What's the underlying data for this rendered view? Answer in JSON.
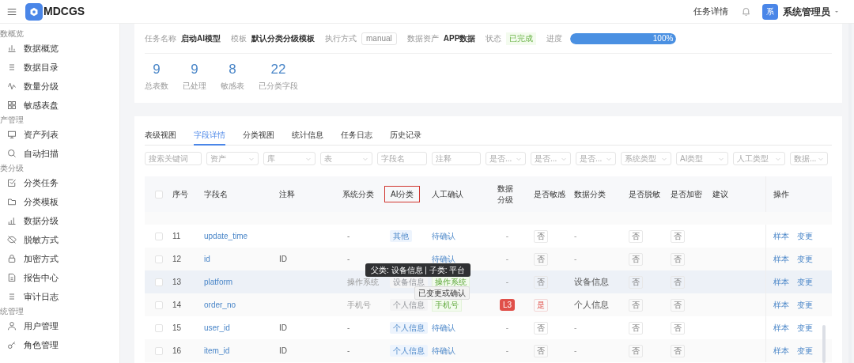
{
  "app": {
    "logo_text": "MDCGS",
    "page_title": "任务详情",
    "avatar": "系",
    "user": "系统管理员"
  },
  "sidebar": [
    {
      "kind": "section",
      "label": "数概览"
    },
    {
      "kind": "item",
      "label": "数据概览",
      "selected": false
    },
    {
      "kind": "item",
      "label": "数据目录",
      "selected": false
    },
    {
      "kind": "item",
      "label": "数量分级",
      "selected": false
    },
    {
      "kind": "item",
      "label": "敏感表盘",
      "selected": false
    },
    {
      "kind": "section",
      "label": "产管理"
    },
    {
      "kind": "item",
      "label": "资产列表",
      "selected": false
    },
    {
      "kind": "item",
      "label": "自动扫描",
      "selected": false
    },
    {
      "kind": "section",
      "label": "类分级"
    },
    {
      "kind": "item",
      "label": "分类任务",
      "selected": false
    },
    {
      "kind": "item",
      "label": "分类模板",
      "selected": false
    },
    {
      "kind": "item",
      "label": "数据分级",
      "selected": false
    },
    {
      "kind": "item",
      "label": "脱敏方式",
      "selected": false
    },
    {
      "kind": "item",
      "label": "加密方式",
      "selected": false
    },
    {
      "kind": "item",
      "label": "报告中心",
      "selected": false
    },
    {
      "kind": "item",
      "label": "审计日志",
      "selected": false
    },
    {
      "kind": "section",
      "label": "统管理"
    },
    {
      "kind": "item",
      "label": "用户管理",
      "selected": false
    },
    {
      "kind": "item",
      "label": "角色管理",
      "selected": false
    }
  ],
  "task": {
    "fields": [
      {
        "kind": "text",
        "label": "任务名称",
        "value": "启动AI模型"
      },
      {
        "kind": "text",
        "label": "模板",
        "value": "默认分类分级模板"
      },
      {
        "kind": "tag",
        "label": "执行方式",
        "value": "manual"
      },
      {
        "kind": "text",
        "label": "数据资产",
        "value": "APP数据"
      },
      {
        "kind": "status",
        "label": "状态",
        "value": "已完成"
      },
      {
        "kind": "progress",
        "label": "进度",
        "value": "100%",
        "level": 1
      }
    ],
    "stats": [
      {
        "value": "9",
        "label": "总表数"
      },
      {
        "value": "9",
        "label": "已处理"
      },
      {
        "value": "8",
        "label": "敏感表"
      },
      {
        "value": "22",
        "label": "已分类字段"
      }
    ]
  },
  "tabs": [
    {
      "label": "表级视图",
      "selected": false
    },
    {
      "label": "字段详情",
      "selected": true
    },
    {
      "label": "分类视图",
      "selected": false
    },
    {
      "label": "统计信息",
      "selected": false
    },
    {
      "label": "任务日志",
      "selected": false
    },
    {
      "label": "历史记录",
      "selected": false
    }
  ],
  "filters": [
    {
      "kind": "input",
      "placeholder": "搜索关键词"
    },
    {
      "kind": "select",
      "placeholder": "资产"
    },
    {
      "kind": "select",
      "placeholder": "库"
    },
    {
      "kind": "select",
      "placeholder": "表"
    },
    {
      "kind": "input",
      "placeholder": "字段名"
    },
    {
      "kind": "input",
      "placeholder": "注释"
    },
    {
      "kind": "select",
      "placeholder": "是否..."
    },
    {
      "kind": "select",
      "placeholder": "是否..."
    },
    {
      "kind": "select",
      "placeholder": "是否..."
    },
    {
      "kind": "select",
      "placeholder": "系统类型"
    },
    {
      "kind": "select",
      "placeholder": "AI类型"
    },
    {
      "kind": "select",
      "placeholder": "人工类型"
    },
    {
      "kind": "select",
      "placeholder": "数据..."
    }
  ],
  "table": {
    "all_checked": false,
    "columns": [
      {
        "label": "序号",
        "highlighted": false
      },
      {
        "label": "字段名",
        "highlighted": false
      },
      {
        "label": "注释",
        "highlighted": false
      },
      {
        "label": "系统分类",
        "highlighted": false
      },
      {
        "label": "AI分类",
        "highlighted": true
      },
      {
        "label": "人工确认",
        "highlighted": false
      },
      {
        "label": "数据分级",
        "highlighted": false
      },
      {
        "label": "是否敏感",
        "highlighted": false
      },
      {
        "label": "数据分类",
        "highlighted": false
      },
      {
        "label": "是否脱敏",
        "highlighted": false
      },
      {
        "label": "是否加密",
        "highlighted": false
      },
      {
        "label": "建议",
        "highlighted": false
      },
      {
        "label": "操作",
        "highlighted": false
      }
    ],
    "rows": [
      {
        "checked": false,
        "no": "11",
        "field": "update_time",
        "sys": "-",
        "ai": "其他",
        "manual": {
          "kind": "pending",
          "text": "待确认"
        },
        "level": "-",
        "sensitive": {
          "text": "否",
          "on": false
        },
        "category": "-",
        "masked": "否",
        "encrypted": "否",
        "actions": [
          "样本",
          "变更"
        ],
        "changed": false,
        "hovered": false
      },
      {
        "checked": false,
        "no": "12",
        "field": "id",
        "comment": "ID",
        "sys": "-",
        "manual": {
          "kind": "pending",
          "text": "待确认"
        },
        "level": "-",
        "sensitive": {
          "text": "否",
          "on": false
        },
        "category": "-",
        "masked": "否",
        "encrypted": "否",
        "actions": [
          "样本",
          "变更"
        ],
        "changed": false,
        "hovered": false
      },
      {
        "checked": false,
        "no": "13",
        "field": "platform",
        "sys": "操作系统",
        "ai": "设备信息",
        "manual": {
          "kind": "tag",
          "text": "操作系统"
        },
        "level": "-",
        "sensitive": {
          "text": "否",
          "on": false
        },
        "category": "设备信息",
        "masked": "否",
        "encrypted": "否",
        "actions": [
          "样本",
          "变更"
        ],
        "changed": true,
        "hovered": true
      },
      {
        "checked": false,
        "no": "14",
        "field": "order_no",
        "sys": "手机号",
        "ai": "个人信息",
        "manual": {
          "kind": "tag",
          "text": "手机号"
        },
        "level": "L3",
        "sensitive": {
          "text": "是",
          "on": true
        },
        "category": "个人信息",
        "masked": "否",
        "encrypted": "否",
        "actions": [
          "样本",
          "变更"
        ],
        "changed": true,
        "hovered": false
      },
      {
        "checked": false,
        "no": "15",
        "field": "user_id",
        "comment": "ID",
        "sys": "-",
        "ai": "个人信息",
        "manual": {
          "kind": "pending",
          "text": "待确认"
        },
        "level": "-",
        "sensitive": {
          "text": "否",
          "on": false
        },
        "category": "-",
        "masked": "否",
        "encrypted": "否",
        "actions": [
          "样本",
          "变更"
        ],
        "changed": false,
        "hovered": false
      },
      {
        "checked": false,
        "no": "16",
        "field": "item_id",
        "comment": "ID",
        "sys": "-",
        "ai": "个人信息",
        "manual": {
          "kind": "pending",
          "text": "待确认"
        },
        "level": "-",
        "sensitive": {
          "text": "否",
          "on": false
        },
        "category": "-",
        "masked": "否",
        "encrypted": "否",
        "actions": [
          "样本",
          "变更"
        ],
        "changed": false,
        "hovered": false
      }
    ]
  },
  "tooltips": [
    "父类: 设备信息 | 子类: 平台",
    "已变更或确认"
  ]
}
